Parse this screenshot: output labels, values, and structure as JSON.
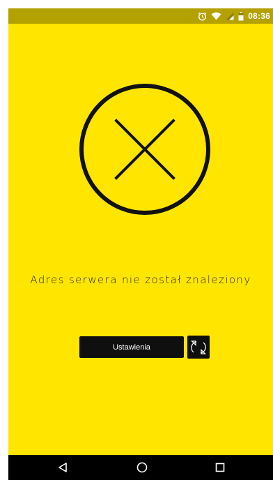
{
  "status_bar": {
    "time": "08:36",
    "icons": [
      "alarm-icon",
      "wifi-icon",
      "signal-icon",
      "battery-icon"
    ]
  },
  "main": {
    "error_icon": "circle-x-icon",
    "message": "Adres serwera nie został znaleziony",
    "settings_label": "Ustawienia",
    "refresh_icon": "refresh-icon"
  },
  "nav_bar": {
    "icons": [
      "back-icon",
      "home-icon",
      "recents-icon"
    ]
  },
  "colors": {
    "background": "#FFE500",
    "status_bar": "#B3A100",
    "button": "#0F0F0F",
    "icon_stroke": "#111111"
  }
}
